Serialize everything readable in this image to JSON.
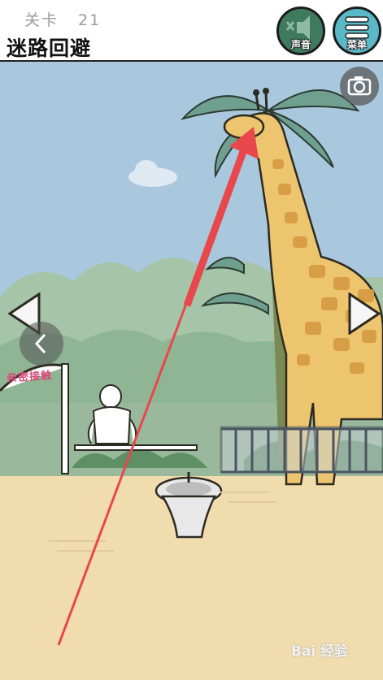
{
  "header": {
    "level_label": "关卡",
    "level_number": "21",
    "title": "迷路回避",
    "sound_label": "声音",
    "menu_label": "菜单"
  },
  "scene": {
    "gate_sign": "亲密接触"
  },
  "icons": {
    "sound": "speaker-muted-icon",
    "menu": "hamburger-menu-icon",
    "camera": "camera-icon",
    "left": "triangle-left-icon",
    "right": "triangle-right-icon",
    "back": "chevron-left-icon"
  },
  "watermark": "Bai 经验",
  "colors": {
    "sky": "#a9c8de",
    "ground": "#f1dcae",
    "giraffe": "#edc56f",
    "giraffe_spots": "#d79e45",
    "leaves": "#6fa08f",
    "arrow": "#e8474c",
    "sound_button": "#3f7a5f",
    "menu_button": "#5ab9c7"
  }
}
